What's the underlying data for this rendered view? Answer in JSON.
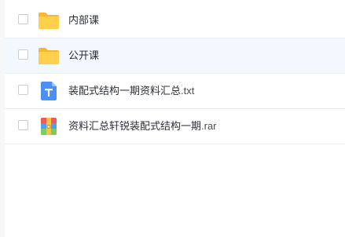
{
  "file_list": {
    "rows": [
      {
        "icon": "folder-icon",
        "name": "内部课",
        "ext": ""
      },
      {
        "icon": "folder-icon",
        "name": "公开课",
        "ext": ""
      },
      {
        "icon": "text-file-icon",
        "name": "装配式结构一期资料汇总",
        "ext": ".txt"
      },
      {
        "icon": "archive-file-icon",
        "name": "资料汇总轩锐装配式结构一期",
        "ext": ".rar"
      }
    ],
    "selected_index": 1
  },
  "colors": {
    "folder": "#ffd04b",
    "folder_tab": "#f7b731",
    "text_file": "#4a90f5",
    "selected_row": "#f3f8fe"
  }
}
